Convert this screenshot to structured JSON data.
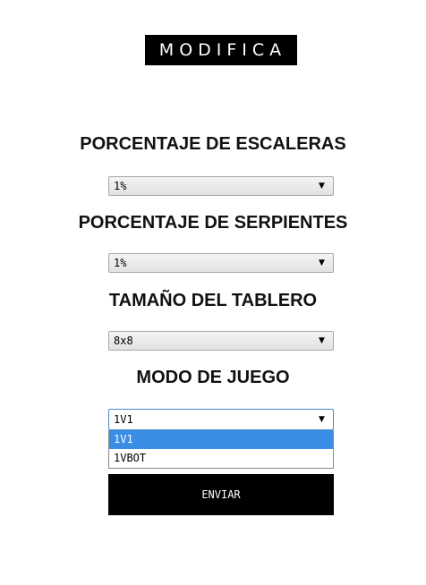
{
  "title": "MODIFICA",
  "fields": [
    {
      "label": "PORCENTAJE DE ESCALERAS",
      "value": "1%"
    },
    {
      "label": "PORCENTAJE DE SERPIENTES",
      "value": "1%"
    },
    {
      "label": "TAMAÑO DEL TABLERO",
      "value": "8x8"
    },
    {
      "label": "MODO DE JUEGO",
      "value": "1V1"
    }
  ],
  "dropdown": {
    "options": [
      "1V1",
      "1VBOT"
    ],
    "selected": "1V1"
  },
  "arrow_glyph": "▼",
  "submit_label": "ENVIAR",
  "colors": {
    "title_bg": "#000000",
    "button_bg": "#000000",
    "option_highlight": "#3a8ee6"
  }
}
